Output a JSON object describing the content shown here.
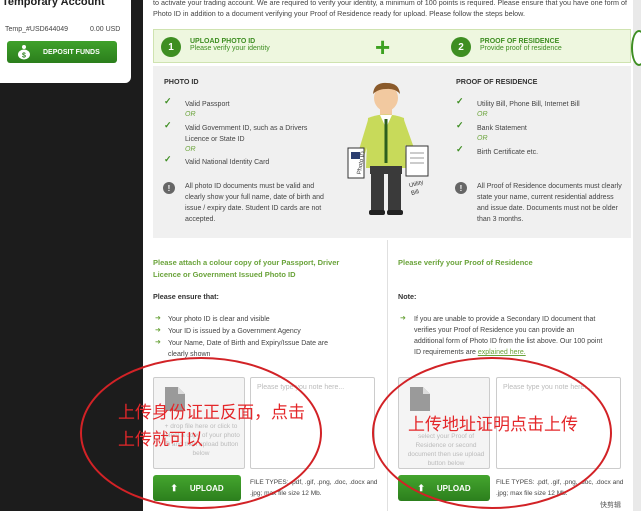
{
  "account": {
    "title": "Temporary Account",
    "id": "Temp_#USD644049",
    "balance": "0.00 USD",
    "deposit_label": "DEPOSIT FUNDS"
  },
  "intro_text": "to activate your trading account. We are required to verify your identity, a minimum of 100 points is required. Please ensure that you have one form of Photo ID in addition to a document verifying your Proof of Residence ready for upload. Please follow the steps below.",
  "steps": [
    {
      "number": "1",
      "title": "UPLOAD PHOTO ID",
      "subtitle": "Please verify your identity"
    },
    {
      "number": "2",
      "title": "PROOF OF RESIDENCE",
      "subtitle": "Provide proof of residence"
    }
  ],
  "photo_id": {
    "heading": "PHOTO ID",
    "items": [
      "Valid Passport",
      "Valid Government ID, such as a Drivers Licence or State ID",
      "Valid National Identity Card"
    ],
    "or_label": "OR",
    "note": "All photo ID documents must be valid and clearly show your full name, date of birth and issue / expiry date. Student ID cards are not accepted."
  },
  "residence": {
    "heading": "PROOF OF RESIDENCE",
    "items": [
      "Utility Bill, Phone Bill, Internet Bill",
      "Bank Statement",
      "Birth Certificate etc."
    ],
    "or_label": "OR",
    "note": "All Proof of Residence documents must clearly state your name, current residential address and issue date. Documents must not be older than 3 months."
  },
  "illustration": {
    "photo_label": "Photo ID",
    "bill_label": "Utility Bill"
  },
  "left_upload": {
    "heading": "Please attach a colour copy of your Passport, Driver Licence or Government Issued Photo ID",
    "ensure_label": "Please ensure that:",
    "bullets": [
      "Your photo ID is clear and visible",
      "Your ID is issued by a Government Agency",
      "Your Name, Date of Birth and Expiry/Issue Date are clearly shown"
    ],
    "dropzone_text": "+ drop file here or click to select a copy of your photo ID and then upload button below",
    "note_placeholder": "Please type you note here...",
    "upload_label": "UPLOAD",
    "filetypes": "FILE TYPES: .pdf, .gif, .png, .doc, .docx and .jpg; max file size 12 Mb."
  },
  "right_upload": {
    "heading": "Please verify your Proof of Residence",
    "note_label": "Note:",
    "note_text": "If you are unable to provide a Secondary ID document that verifies your Proof of Residence you can provide an additional form of Photo ID from the list above. Our 100 point ID requirements are",
    "link_text": "explained here.",
    "dropzone_text": "select your Proof of Residence or second document then use upload button below",
    "note_placeholder": "Please type you note here...",
    "upload_label": "UPLOAD",
    "filetypes": "FILE TYPES: .pdf, .gif, .png, .doc, .docx and .jpg; max file size 12 Mb."
  },
  "annotations": {
    "left": "上传身份证正反面，点击上传就可以",
    "right": "上传地址证明点击上传"
  },
  "watermark": "快剪辑",
  "colors": {
    "brand_green": "#3e8e22",
    "annotation_red": "#d22226"
  }
}
